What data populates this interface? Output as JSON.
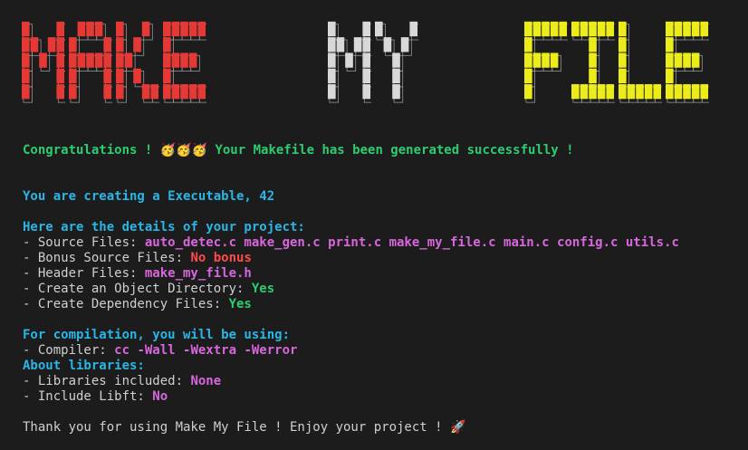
{
  "banner": {
    "words": [
      {
        "text": "MAKE",
        "color": "#e53935"
      },
      {
        "text": "MY",
        "color": "#d8d8d8"
      },
      {
        "text": "FILE",
        "color": "#ecec1a"
      }
    ]
  },
  "terminal": {
    "congrats_prefix": "Congratulations ! ",
    "congrats_emoji": "🥳🥳🥳",
    "congrats_suffix": " Your Makefile has been generated successfully !",
    "creating": "You are creating a Executable, 42",
    "details_header": "Here are the details of your project:",
    "source_label": "- Source Files: ",
    "source_value": "auto_detec.c make_gen.c print.c make_my_file.c main.c config.c utils.c",
    "bonus_label": "- Bonus Source Files: ",
    "bonus_value": "No bonus",
    "header_label": "- Header Files: ",
    "header_value": "make_my_file.h",
    "objdir_label": "- Create an Object Directory: ",
    "objdir_value": "Yes",
    "dep_label": "- Create Dependency Files: ",
    "dep_value": "Yes",
    "compilation_header": "For compilation, you will be using:",
    "compiler_label": "- Compiler: ",
    "compiler_value": "cc -Wall -Wextra -Werror",
    "libraries_header": "About libraries:",
    "libs_label": "- Libraries included: ",
    "libs_value": "None",
    "libft_label": "- Include Libft: ",
    "libft_value": "No",
    "thanks": "Thank you for using Make My File ! Enjoy your project ! ",
    "thanks_emoji": "🚀"
  }
}
